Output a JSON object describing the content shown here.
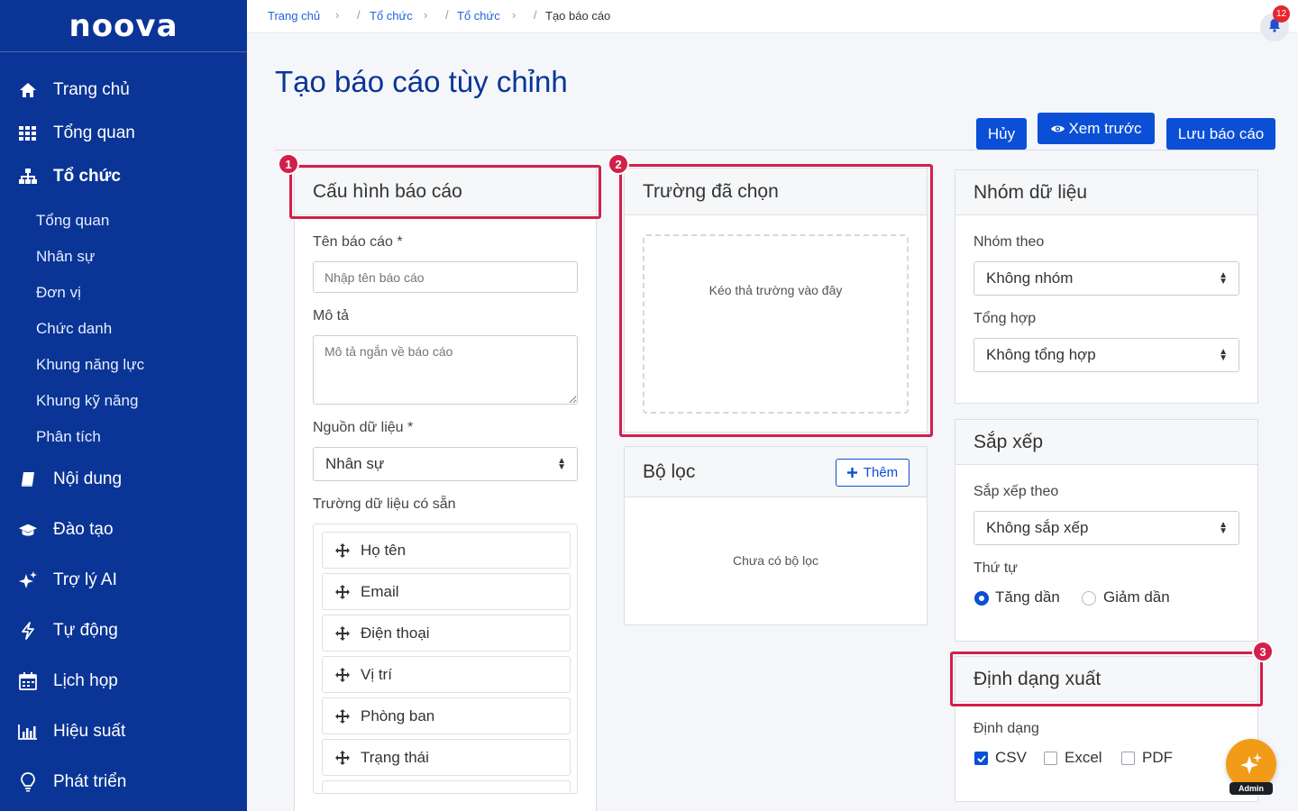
{
  "brand": {
    "logo": "noova"
  },
  "sidebar": {
    "items": [
      {
        "label": "Trang chủ",
        "icon": "home-icon"
      },
      {
        "label": "Tổng quan",
        "icon": "grid-icon"
      },
      {
        "label": "Tổ chức",
        "icon": "org-icon"
      },
      {
        "label": "Nội dung",
        "icon": "book-icon"
      },
      {
        "label": "Đào tạo",
        "icon": "graduation-cap-icon"
      },
      {
        "label": "Trợ lý AI",
        "icon": "sparkle-icon"
      },
      {
        "label": "Tự động",
        "icon": "bolt-icon"
      },
      {
        "label": "Lịch họp",
        "icon": "calendar-icon"
      },
      {
        "label": "Hiệu suất",
        "icon": "bar-chart-icon"
      },
      {
        "label": "Phát triển",
        "icon": "lightbulb-icon"
      }
    ],
    "sub_items": [
      "Tổng quan",
      "Nhân sự",
      "Đơn vị",
      "Chức danh",
      "Khung năng lực",
      "Khung kỹ năng",
      "Phân tích"
    ]
  },
  "breadcrumb": [
    "Trang chủ",
    "Tổ chức",
    "Tổ chức",
    "Tạo báo cáo"
  ],
  "notifications": {
    "count": "12"
  },
  "page": {
    "title": "Tạo báo cáo tùy chỉnh"
  },
  "actions": {
    "cancel": "Hủy",
    "preview": "Xem trước",
    "save": "Lưu báo cáo"
  },
  "config": {
    "title": "Cấu hình báo cáo",
    "name_label": "Tên báo cáo *",
    "name_placeholder": "Nhập tên báo cáo",
    "desc_label": "Mô tả",
    "desc_placeholder": "Mô tả ngắn về báo cáo",
    "source_label": "Nguồn dữ liệu *",
    "source_value": "Nhân sự",
    "fields_label": "Trường dữ liệu có sẵn",
    "fields": [
      "Họ tên",
      "Email",
      "Điện thoại",
      "Vị trí",
      "Phòng ban",
      "Trạng thái"
    ]
  },
  "selected": {
    "title": "Trường đã chọn",
    "dropzone": "Kéo thả trường vào đây"
  },
  "filters": {
    "title": "Bộ lọc",
    "add": "Thêm",
    "empty": "Chưa có bộ lọc"
  },
  "grouping": {
    "title": "Nhóm dữ liệu",
    "group_label": "Nhóm theo",
    "group_value": "Không nhóm",
    "agg_label": "Tổng hợp",
    "agg_value": "Không tổng hợp"
  },
  "sorting": {
    "title": "Sắp xếp",
    "sort_label": "Sắp xếp theo",
    "sort_value": "Không sắp xếp",
    "order_label": "Thứ tự",
    "asc": "Tăng dần",
    "desc": "Giảm dần"
  },
  "export": {
    "title": "Định dạng xuất",
    "format_label": "Định dạng",
    "csv": "CSV",
    "excel": "Excel",
    "pdf": "PDF"
  },
  "markers": [
    "1",
    "2",
    "3"
  ],
  "assistant": {
    "tag": "Admin"
  },
  "colors": {
    "sidebar": "#0a3596",
    "primary": "#0b4fd6",
    "highlight": "#d31f4b",
    "fab": "#f29b17"
  }
}
